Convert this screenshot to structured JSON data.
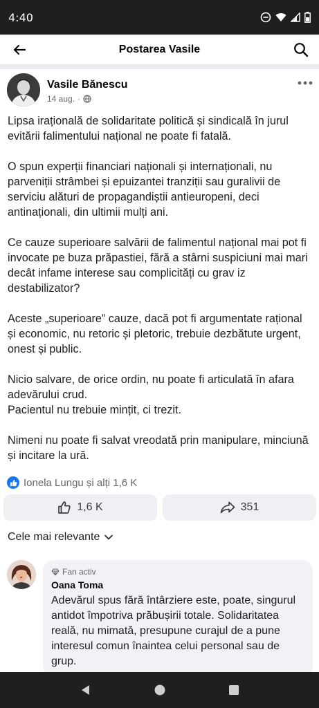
{
  "status_bar": {
    "time": "4:40"
  },
  "appbar": {
    "title": "Postarea Vasile"
  },
  "post": {
    "author": "Vasile Bănescu",
    "date": "14 aug.",
    "meta_separator": "·",
    "paragraphs": [
      "Lipsa irațională de solidaritate politică și sindicală în jurul evitării falimentului național ne poate fi fatală.",
      "O spun experții financiari naționali și internaționali, nu parveniții strâmbei și epuizantei tranziții sau guralivii de serviciu alături de propagandiștii antieuropeni, deci antinaționali, din ultimii mulți ani.",
      "Ce cauze superioare salvării de falimentul național mai pot fi invocate pe buza prăpastiei, fără a stârni suspiciuni mai mari decât infame interese sau complicități cu grav iz destabilizator?",
      "Aceste „superioare” cauze, dacă pot fi argumentate rațional și economic, nu retoric și pletoric, trebuie dezbătute urgent, onest și public.",
      "Nicio salvare, de orice ordin, nu poate fi articulată în afara adevărului crud.\nPacientul nu trebuie mințit, ci trezit.",
      "Nimeni nu poate fi salvat vreodată prin manipulare, minciună și incitare la ură."
    ],
    "reactions_summary": "Ionela Lungu și alți 1,6 K",
    "like_count": "1,6 K",
    "share_count": "351"
  },
  "comments": {
    "sort_label": "Cele mai relevante",
    "items": [
      {
        "badge": "Fan activ",
        "name": "Oana Toma",
        "text": "Adevărul spus fără întârziere este, poate, singurul antidot împotriva prăbușirii totale. Solidaritatea reală, nu mimată, presupune curajul de a pune interesul comun înaintea celui personal sau de grup."
      }
    ]
  },
  "icons": {
    "back": "arrow-left-icon",
    "search": "search-icon",
    "more": "more-dots-icon",
    "globe": "globe-icon",
    "like": "thumbs-up-icon",
    "share": "share-arrow-icon",
    "chevron": "chevron-down-icon",
    "badge": "diamond-icon"
  },
  "colors": {
    "accent": "#1877f2",
    "button_bg": "#eef0f3",
    "bubble_bg": "#f0f2f5",
    "system_bar": "#1f1f1f"
  }
}
